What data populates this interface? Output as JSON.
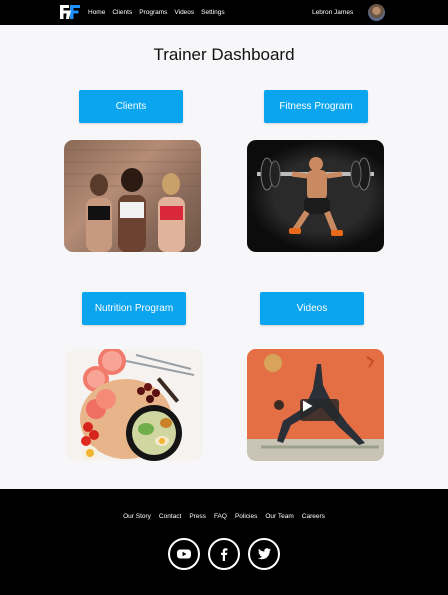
{
  "nav": {
    "logo": "FF logo",
    "links": [
      "Home",
      "Clients",
      "Programs",
      "Videos",
      "Settings"
    ],
    "user_name": "Lebron James"
  },
  "page_title": "Trainer Dashboard",
  "sections": {
    "clients_label": "Clients",
    "fitness_label": "Fitness Program",
    "nutrition_label": "Nutrition Program",
    "videos_label": "Videos"
  },
  "footer": {
    "links": [
      "Our Story",
      "Contact",
      "Press",
      "FAQ",
      "Policies",
      "Our Team",
      "Careers"
    ]
  },
  "icons": [
    "ff-logo-icon",
    "avatar",
    "play-icon",
    "youtube-icon",
    "facebook-icon",
    "twitter-icon"
  ],
  "colors": {
    "accent": "#0aa4ef",
    "nav_bg": "#000000",
    "page_bg": "#f7f7f9"
  }
}
